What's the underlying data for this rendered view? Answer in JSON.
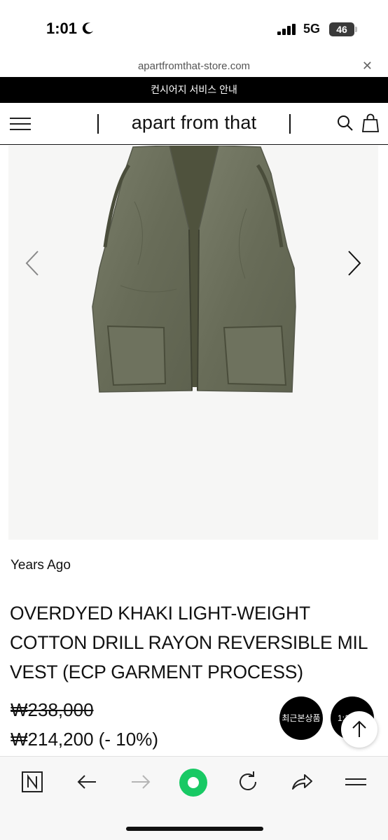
{
  "status_bar": {
    "time": "1:01",
    "network": "5G",
    "battery": "46"
  },
  "browser": {
    "url": "apartfromthat-store.com"
  },
  "announcement": "컨시어지 서비스 안내",
  "header": {
    "brand": "apart from that"
  },
  "product": {
    "vendor": "Years Ago",
    "title": "OVERDYED KHAKI LIGHT-WEIGHT COTTON DRILL RAYON REVERSIBLE MIL VEST (ECP GARMENT PROCESS)",
    "price_original": "₩238,000",
    "price_sale": "₩214,200 (- 10%)"
  },
  "floating": {
    "recent_label": "최근본상품",
    "chat_label": "1:1"
  },
  "colors": {
    "announcement_bg": "#000000",
    "vest_khaki": "#6b6f5c",
    "vest_lining": "#4d5039",
    "active_green": "#18c964"
  },
  "icons": [
    "moon-icon",
    "signal-icon",
    "close-icon",
    "menu-icon",
    "search-icon",
    "bag-icon",
    "chevron-left-icon",
    "chevron-right-icon",
    "arrow-up-icon",
    "naver-icon",
    "back-icon",
    "forward-icon",
    "home-icon",
    "reload-icon",
    "share-icon",
    "browser-menu-icon"
  ]
}
